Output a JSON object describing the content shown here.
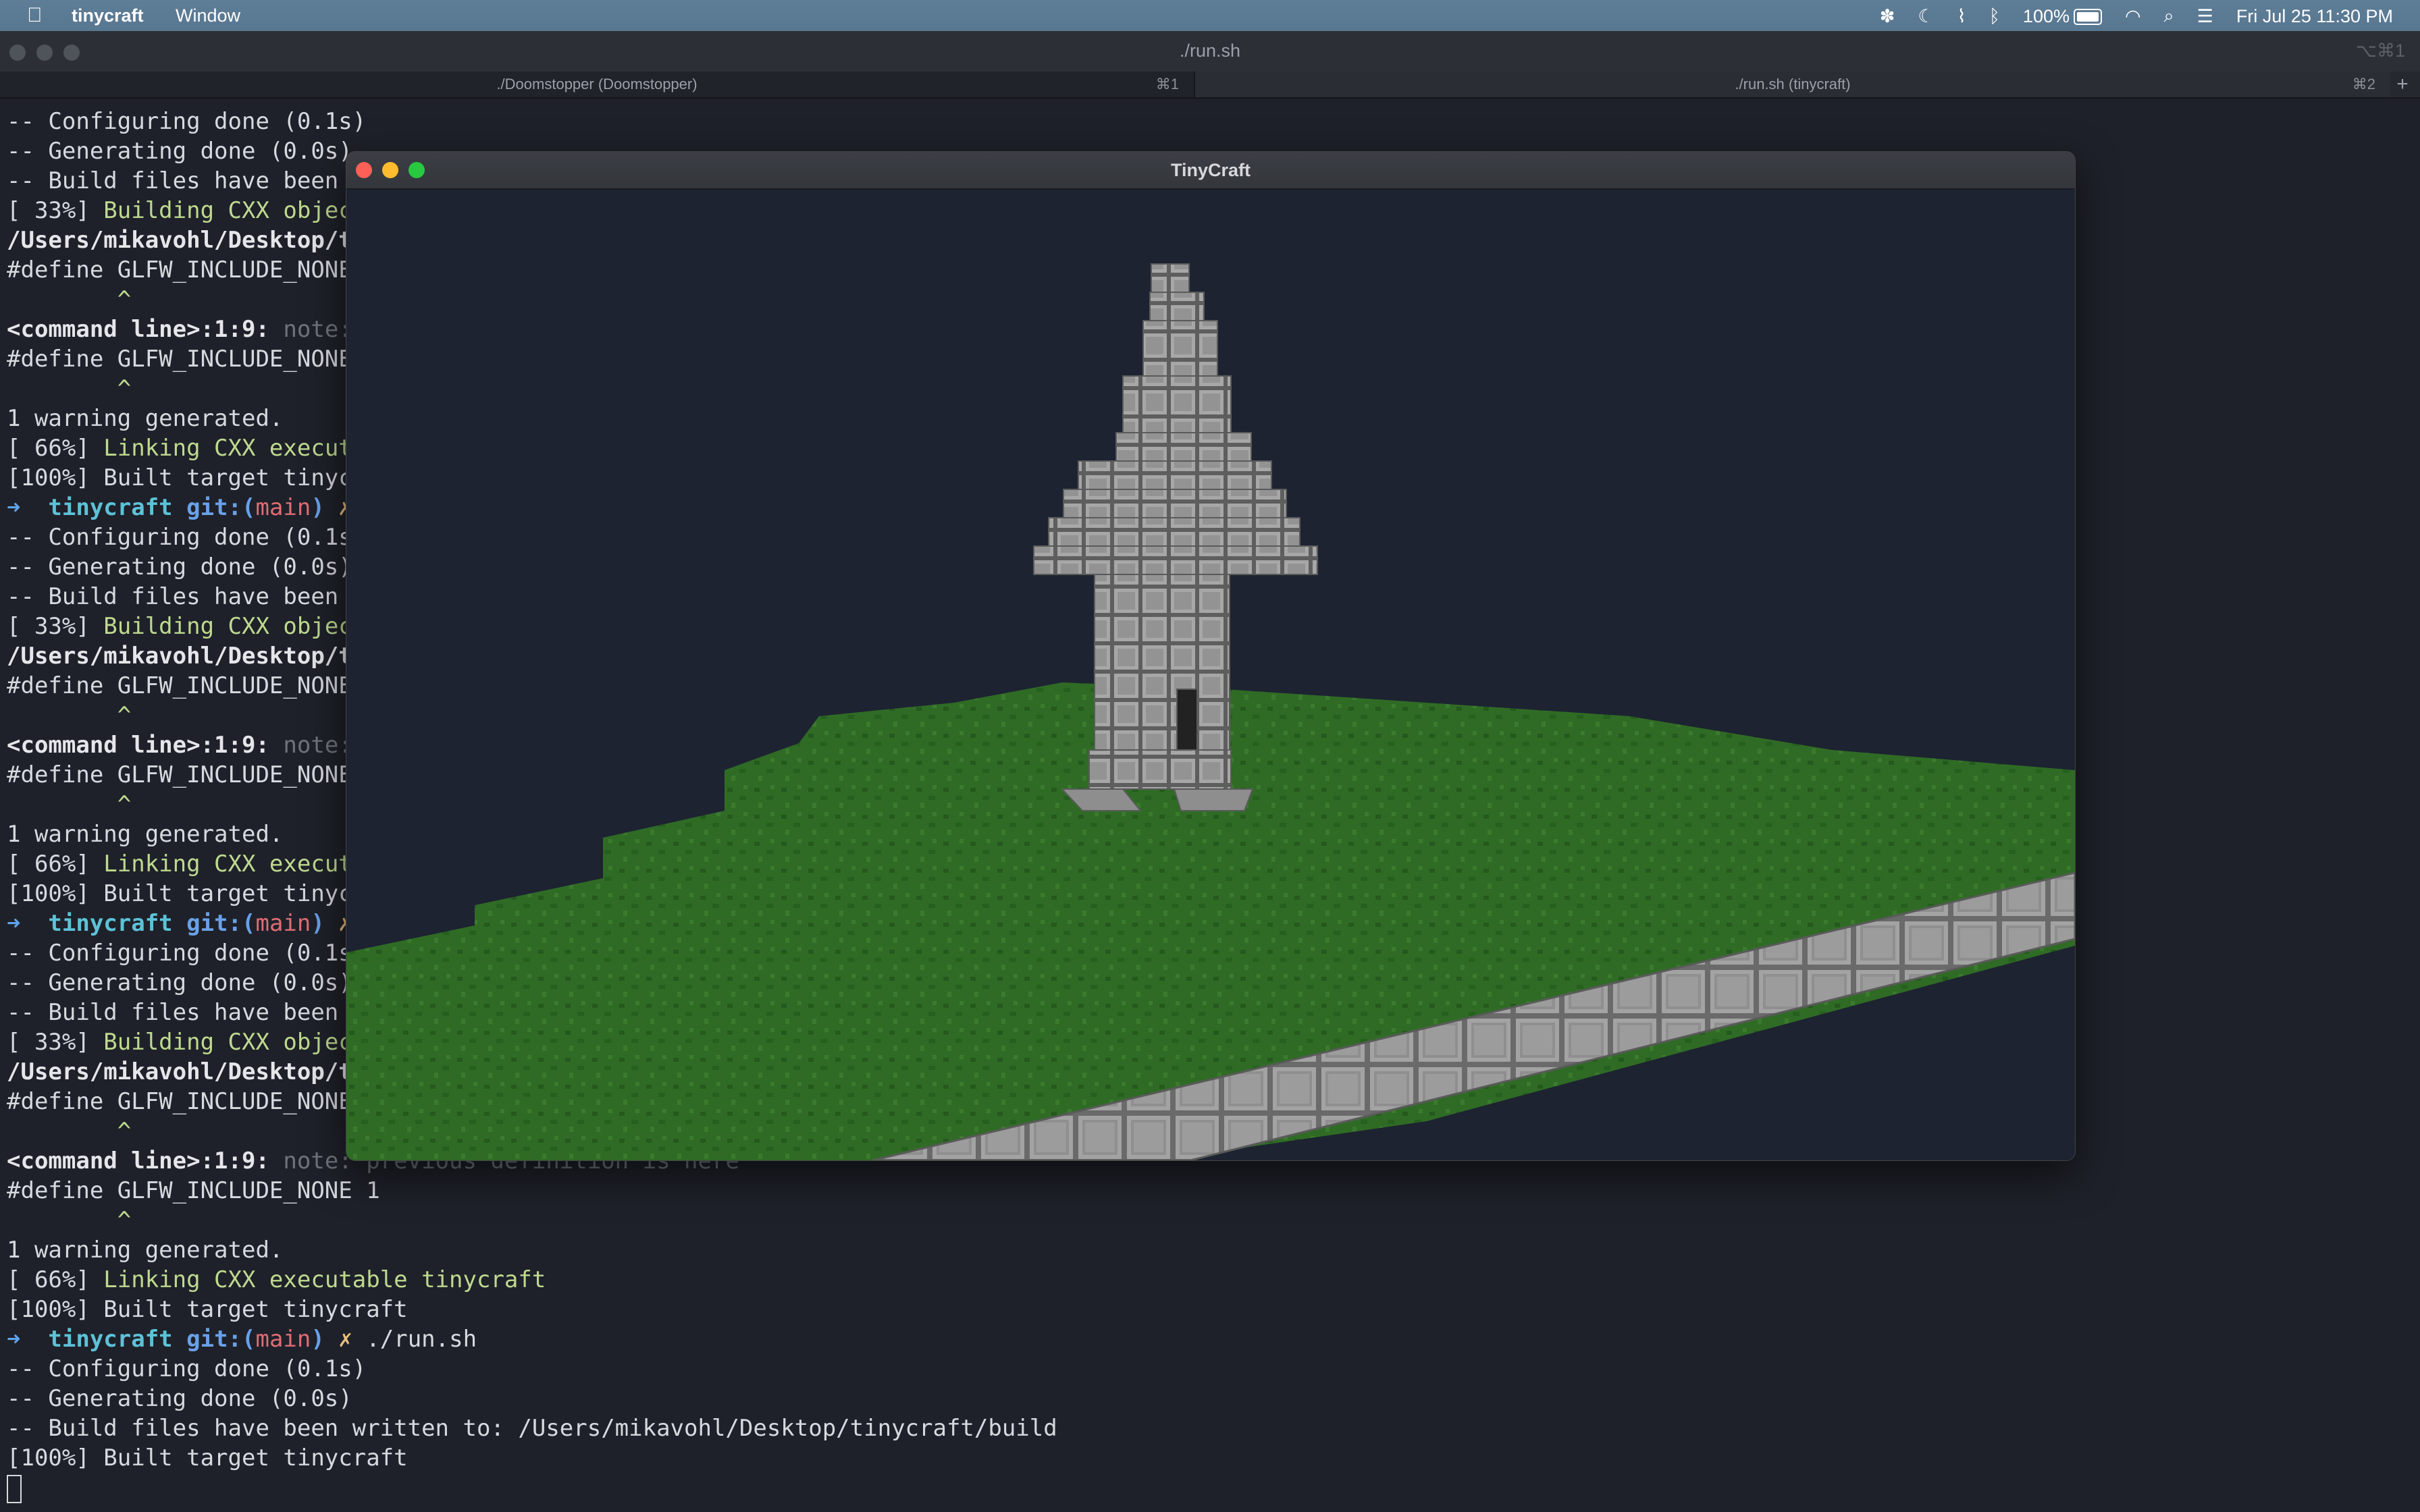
{
  "menubar": {
    "apple_icon": "apple-logo-icon",
    "app_name": "tinycraft",
    "window_menu": "Window",
    "battery": "100%",
    "clock": "Fri Jul 25  11:30 PM",
    "status_icons": [
      "fan-icon",
      "moon-icon",
      "antenna-icon",
      "bluetooth-icon",
      "battery-icon",
      "wifi-icon",
      "search-icon",
      "control-center-icon"
    ]
  },
  "terminal": {
    "title": "./run.sh",
    "title_shortcut": "⌥⌘1",
    "tabs": [
      {
        "label": "./Doomstopper (Doomstopper)",
        "key": "⌘1"
      },
      {
        "label": "./run.sh (tinycraft)",
        "key": "⌘2"
      }
    ],
    "new_tab": "+",
    "lines": [
      [
        {
          "t": "-- Configuring done (0.1s)",
          "c": ""
        }
      ],
      [
        {
          "t": "-- Generating done (0.0s)",
          "c": ""
        }
      ],
      [
        {
          "t": "-- Build files have been written to: /Users/mikavohl/Desktop/tinycraft/build",
          "c": ""
        }
      ],
      [
        {
          "t": "[ 33%] ",
          "c": ""
        },
        {
          "t": "Building CXX object CMakeFiles/tinycraft.dir/src/main.cpp.o",
          "c": "green"
        }
      ],
      [
        {
          "t": "/Users/mikavohl/Desktop/tinycraft/src/main.cpp",
          "c": "bold"
        }
      ],
      [
        {
          "t": "#define GLFW_INCLUDE_NONE",
          "c": ""
        }
      ],
      [
        {
          "t": "        ^",
          "c": "green"
        }
      ],
      [
        {
          "t": "<command line>:1:9: ",
          "c": "bold"
        },
        {
          "t": "note: previous definition is here",
          "c": "gray"
        }
      ],
      [
        {
          "t": "#define GLFW_INCLUDE_NONE 1",
          "c": ""
        }
      ],
      [
        {
          "t": "        ^",
          "c": "green"
        }
      ],
      [
        {
          "t": "1 warning generated.",
          "c": ""
        }
      ],
      [
        {
          "t": "[ 66%] ",
          "c": ""
        },
        {
          "t": "Linking CXX executable tinycraft",
          "c": "green"
        }
      ],
      [
        {
          "t": "[100%] Built target tinycraft",
          "c": ""
        }
      ],
      [
        {
          "t": "➜  ",
          "c": "arrow"
        },
        {
          "t": "tinycraft ",
          "c": "cyan"
        },
        {
          "t": "git:(",
          "c": "blue"
        },
        {
          "t": "main",
          "c": "red"
        },
        {
          "t": ") ",
          "c": "blue"
        },
        {
          "t": "✗ ",
          "c": "yellow"
        },
        {
          "t": "./run.sh",
          "c": ""
        }
      ],
      [
        {
          "t": "-- Configuring done (0.1s)",
          "c": ""
        }
      ],
      [
        {
          "t": "-- Generating done (0.0s)",
          "c": ""
        }
      ],
      [
        {
          "t": "-- Build files have been written to: /Users/mikavohl/Desktop/tinycraft/build",
          "c": ""
        }
      ],
      [
        {
          "t": "[ 33%] ",
          "c": ""
        },
        {
          "t": "Building CXX object CMakeFiles/tinycraft.dir/src/main.cpp.o",
          "c": "green"
        }
      ],
      [
        {
          "t": "/Users/mikavohl/Desktop/tinycraft/src/main.cpp",
          "c": "bold"
        }
      ],
      [
        {
          "t": "#define GLFW_INCLUDE_NONE",
          "c": ""
        }
      ],
      [
        {
          "t": "        ^",
          "c": "green"
        }
      ],
      [
        {
          "t": "<command line>:1:9: ",
          "c": "bold"
        },
        {
          "t": "note: previous definition is here",
          "c": "gray"
        }
      ],
      [
        {
          "t": "#define GLFW_INCLUDE_NONE 1",
          "c": ""
        }
      ],
      [
        {
          "t": "        ^",
          "c": "green"
        }
      ],
      [
        {
          "t": "1 warning generated.",
          "c": ""
        }
      ],
      [
        {
          "t": "[ 66%] ",
          "c": ""
        },
        {
          "t": "Linking CXX executable tinycraft",
          "c": "green"
        }
      ],
      [
        {
          "t": "[100%] Built target tinycraft",
          "c": ""
        }
      ],
      [
        {
          "t": "➜  ",
          "c": "arrow"
        },
        {
          "t": "tinycraft ",
          "c": "cyan"
        },
        {
          "t": "git:(",
          "c": "blue"
        },
        {
          "t": "main",
          "c": "red"
        },
        {
          "t": ") ",
          "c": "blue"
        },
        {
          "t": "✗ ",
          "c": "yellow"
        },
        {
          "t": "./run.sh",
          "c": ""
        }
      ],
      [
        {
          "t": "-- Configuring done (0.1s)",
          "c": ""
        }
      ],
      [
        {
          "t": "-- Generating done (0.0s)",
          "c": ""
        }
      ],
      [
        {
          "t": "-- Build files have been written to: /Users/mikavohl/Desktop/tinycraft/build",
          "c": ""
        }
      ],
      [
        {
          "t": "[ 33%] ",
          "c": ""
        },
        {
          "t": "Building CXX object CMakeFiles/tinycraft.dir/src/main.cpp.o",
          "c": "green"
        }
      ],
      [
        {
          "t": "/Users/mikavohl/Desktop/tinycraft/src/main.cpp",
          "c": "bold"
        }
      ],
      [
        {
          "t": "#define GLFW_INCLUDE_NONE",
          "c": ""
        }
      ],
      [
        {
          "t": "        ^",
          "c": "green"
        }
      ],
      [
        {
          "t": "<command line>:1:9: ",
          "c": "bold"
        },
        {
          "t": "note: previous definition is here",
          "c": "gray"
        }
      ],
      [
        {
          "t": "#define GLFW_INCLUDE_NONE 1",
          "c": ""
        }
      ],
      [
        {
          "t": "        ^",
          "c": "green"
        }
      ],
      [
        {
          "t": "1 warning generated.",
          "c": ""
        }
      ],
      [
        {
          "t": "[ 66%] ",
          "c": ""
        },
        {
          "t": "Linking CXX executable tinycraft",
          "c": "green"
        }
      ],
      [
        {
          "t": "[100%] Built target tinycraft",
          "c": ""
        }
      ],
      [
        {
          "t": "➜  ",
          "c": "arrow"
        },
        {
          "t": "tinycraft ",
          "c": "cyan"
        },
        {
          "t": "git:(",
          "c": "blue"
        },
        {
          "t": "main",
          "c": "red"
        },
        {
          "t": ") ",
          "c": "blue"
        },
        {
          "t": "✗ ",
          "c": "yellow"
        },
        {
          "t": "./run.sh",
          "c": ""
        }
      ],
      [
        {
          "t": "-- Configuring done (0.1s)",
          "c": ""
        }
      ],
      [
        {
          "t": "-- Generating done (0.0s)",
          "c": ""
        }
      ],
      [
        {
          "t": "-- Build files have been written to: /Users/mikavohl/Desktop/tinycraft/build",
          "c": ""
        }
      ],
      [
        {
          "t": "[100%] Built target tinycraft",
          "c": ""
        }
      ]
    ]
  },
  "game": {
    "title": "TinyCraft",
    "colors": {
      "sky": "#1d2331",
      "grass": "#2f6b25",
      "grass_dark": "#245a1c",
      "stone": "#9a9a9a",
      "stone_edge": "#5c5c5c"
    }
  }
}
